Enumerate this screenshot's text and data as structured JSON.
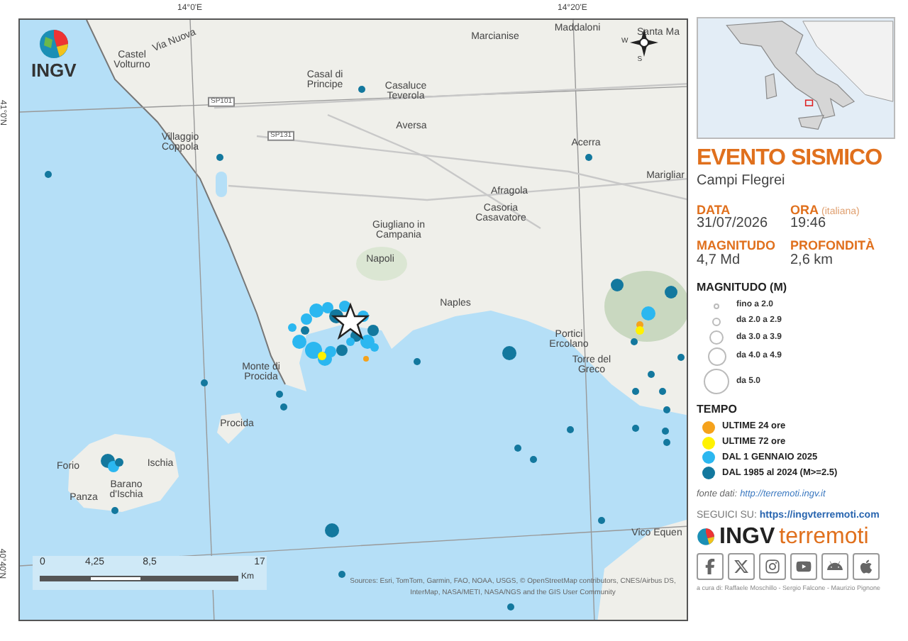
{
  "map": {
    "coordinate_labels": [
      "14°0'E",
      "14°20'E",
      "41°0'N",
      "40°40'N"
    ],
    "logo": "INGV",
    "places": [
      "Castel\nVolturno",
      "Via Nuova",
      "Casal di\nPrincipe",
      "SP101",
      "SP131",
      "Villaggio\nCoppola",
      "Marcianise",
      "Maddaloni",
      "Santa Ma",
      "Casaluce\nTeverola",
      "Aversa",
      "Acerra",
      "Marigliar",
      "Afragola",
      "Casoria\nCasavatore",
      "Giugliano in\nCampania",
      "Napoli",
      "Naples",
      "Portici\nErcolano",
      "Torre del\nGreco",
      "Monte di\nProcida",
      "Procida",
      "Forio",
      "Ischia",
      "Barano\nd'Ischia",
      "Panza",
      "Vico Equen"
    ],
    "compass": [
      "W",
      "S"
    ],
    "scale_bar": {
      "ticks": [
        "0",
        "4,25",
        "8,5",
        "17"
      ],
      "unit": "Km"
    },
    "attribution": "Sources: Esri, TomTom, Garmin, FAO, NOAA, USGS, © OpenStreetMap contributors, CNES/Airbus DS, InterMap, NASA/METI, NASA/NGS and the GIS User Community"
  },
  "panel": {
    "title": "EVENTO SISMICO",
    "location": "Campi Flegrei",
    "fields": [
      {
        "label": "DATA",
        "value": "31/07/2026"
      },
      {
        "label": "ORA",
        "note": "(italiana)",
        "value": "19:46"
      },
      {
        "label": "MAGNITUDO",
        "value": "4,7 Md"
      },
      {
        "label": "PROFONDITÀ",
        "value": "2,6 km"
      }
    ],
    "magnitude_legend": {
      "title": "MAGNITUDO (M)",
      "items": [
        "fino a 2.0",
        "da 2.0 a 2.9",
        "da 3.0 a 3.9",
        "da 4.0 a 4.9",
        "da 5.0"
      ]
    },
    "time_legend": {
      "title": "TEMPO",
      "items": [
        {
          "label": "ULTIME 24 ore",
          "color": "#f5a21b"
        },
        {
          "label": "ULTIME 72 ore",
          "color": "#fff200"
        },
        {
          "label": "DAL 1 GENNAIO 2025",
          "color": "#2bb7f0"
        },
        {
          "label": "DAL 1985 al 2024 (M>=2.5)",
          "color": "#13789e"
        }
      ]
    },
    "source": {
      "label": "fonte dati:",
      "link": "http://terremoti.ingv.it"
    },
    "follow": {
      "label": "SEGUICI SU:",
      "link": "https://ingvterremoti.com"
    },
    "brand": {
      "name": "INGV",
      "suffix": "terremoti"
    },
    "credits": "a cura di: Raffaele Moschillo - Sergio Falcone - Maurizio Pignone"
  }
}
